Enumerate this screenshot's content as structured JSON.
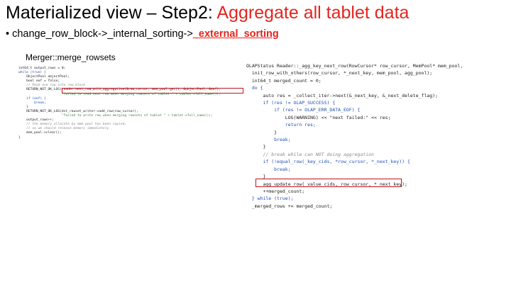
{
  "title": {
    "prefix": "Materialized view – Step2: ",
    "highlight": "Aggregate all tablet data"
  },
  "bullet": {
    "symbol": "•",
    "prefix": "change_row_block->_internal_sorting->",
    "highlight": "_external_sorting"
  },
  "left_label": "Merger::merge_rowsets",
  "colors": {
    "accent": "#e3251f",
    "keyword": "#1f4fb5",
    "comment": "#8a8a8a",
    "string": "#3f7f3f"
  },
  "left_code": [
    {
      "t": "int64_t output_rows = 0;",
      "k": "plain"
    },
    {
      "t": "while (true) {",
      "k": "kw"
    },
    {
      "t": "    ObjectPool objectPool;",
      "k": "plain"
    },
    {
      "t": "    bool eof = false;",
      "k": "plain"
    },
    {
      "t": "    // Read one row into row_block",
      "k": "cm"
    },
    {
      "t": "    RETURN_NOT_OK_LOG(reader.next_row_with_aggregation(&row_cursor, mem_pool.get(), &objectPool, &eof),",
      "k": "plain"
    },
    {
      "t": "                      \"failed to read next row when merging rowsets of tablet \" + tablet->full_name());",
      "k": "str"
    },
    {
      "t": "    if (eof) {",
      "k": "kw"
    },
    {
      "t": "        break;",
      "k": "kw"
    },
    {
      "t": "    }",
      "k": "plain"
    },
    {
      "t": "    RETURN_NOT_OK_LOG(dst_rowset_writer->add_row(row_cursor),",
      "k": "plain"
    },
    {
      "t": "                      \"failed to write row when merging rowsets of tablet \" + tablet->full_name());",
      "k": "str"
    },
    {
      "t": "    output_rows++;",
      "k": "plain"
    },
    {
      "t": "    // the memory allocate by mem pool has been copied,",
      "k": "cm"
    },
    {
      "t": "    // so we should release memory immediately",
      "k": "cm"
    },
    {
      "t": "    mem_pool->clear();",
      "k": "plain"
    },
    {
      "t": "}",
      "k": "plain"
    }
  ],
  "right_code": [
    {
      "t": "OLAPStatus Reader::_agg_key_next_row(RowCursor* row_cursor, MemPool* mem_pool,",
      "k": "plain"
    },
    {
      "t": "  init_row_with_others(row_cursor, *_next_key, mem_pool, agg_pool);",
      "k": "plain"
    },
    {
      "t": "  int64_t merged_count = 0;",
      "k": "plain"
    },
    {
      "t": "  do {",
      "k": "kw"
    },
    {
      "t": "      auto res = _collect_iter->next(&_next_key, &_next_delete_flag);",
      "k": "plain"
    },
    {
      "t": "      if (res != OLAP_SUCCESS) {",
      "k": "kw"
    },
    {
      "t": "          if (res != OLAP_ERR_DATA_EOF) {",
      "k": "kw"
    },
    {
      "t": "              LOG(WARNING) << \"next failed:\" << res;",
      "k": "plain"
    },
    {
      "t": "              return res;",
      "k": "kw"
    },
    {
      "t": "          }",
      "k": "plain"
    },
    {
      "t": "          break;",
      "k": "kw"
    },
    {
      "t": "      }",
      "k": "plain"
    },
    {
      "t": "      // break while can NOT doing aggregation",
      "k": "cm"
    },
    {
      "t": "      if (!equal_row(_key_cids, *row_cursor, *_next_key)) {",
      "k": "kw"
    },
    {
      "t": "          break;",
      "k": "kw"
    },
    {
      "t": "      }",
      "k": "plain"
    },
    {
      "t": "      agg_update_row(_value_cids, row_cursor, *_next_key);",
      "k": "plain"
    },
    {
      "t": "      ++merged_count;",
      "k": "plain"
    },
    {
      "t": "  } while (true);",
      "k": "kw"
    },
    {
      "t": "  _merged_rows += merged_count;",
      "k": "plain"
    }
  ]
}
